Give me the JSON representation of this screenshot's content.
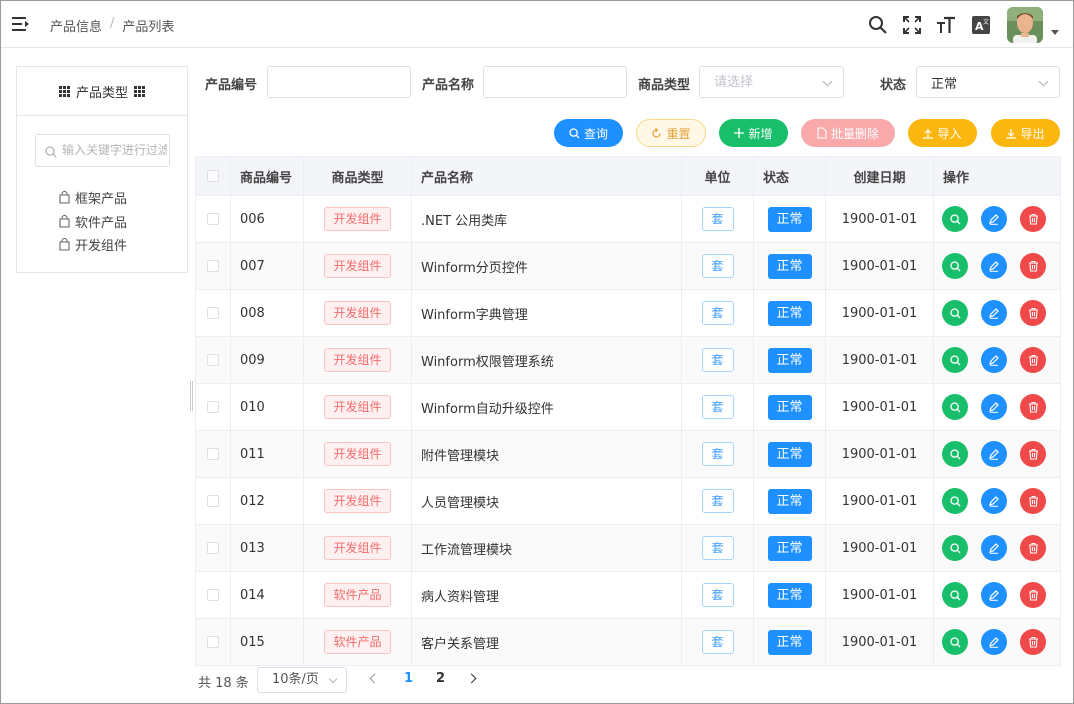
{
  "header": {
    "breadcrumb": [
      "产品信息",
      "产品列表"
    ],
    "breadcrumb_sep": "/"
  },
  "sidebar": {
    "title": "产品类型",
    "search_placeholder": "输入关键字进行过滤",
    "items": [
      {
        "label": "框架产品"
      },
      {
        "label": "软件产品"
      },
      {
        "label": "开发组件"
      }
    ]
  },
  "filters": {
    "code_label": "产品编号",
    "code_value": "",
    "name_label": "产品名称",
    "name_value": "",
    "type_label": "商品类型",
    "type_placeholder": "请选择",
    "status_label": "状态",
    "status_value": "正常"
  },
  "actions": {
    "query": "查询",
    "reset": "重置",
    "add": "新增",
    "batch_delete": "批量删除",
    "import": "导入",
    "export": "导出"
  },
  "table": {
    "columns": [
      "商品编号",
      "商品类型",
      "产品名称",
      "单位",
      "状态",
      "创建日期",
      "操作"
    ],
    "rows": [
      {
        "code": "006",
        "type": "开发组件",
        "name": ".NET 公用类库",
        "unit": "套",
        "status": "正常",
        "date": "1900-01-01"
      },
      {
        "code": "007",
        "type": "开发组件",
        "name": "Winform分页控件",
        "unit": "套",
        "status": "正常",
        "date": "1900-01-01"
      },
      {
        "code": "008",
        "type": "开发组件",
        "name": "Winform字典管理",
        "unit": "套",
        "status": "正常",
        "date": "1900-01-01"
      },
      {
        "code": "009",
        "type": "开发组件",
        "name": "Winform权限管理系统",
        "unit": "套",
        "status": "正常",
        "date": "1900-01-01"
      },
      {
        "code": "010",
        "type": "开发组件",
        "name": "Winform自动升级控件",
        "unit": "套",
        "status": "正常",
        "date": "1900-01-01"
      },
      {
        "code": "011",
        "type": "开发组件",
        "name": "附件管理模块",
        "unit": "套",
        "status": "正常",
        "date": "1900-01-01"
      },
      {
        "code": "012",
        "type": "开发组件",
        "name": "人员管理模块",
        "unit": "套",
        "status": "正常",
        "date": "1900-01-01"
      },
      {
        "code": "013",
        "type": "开发组件",
        "name": "工作流管理模块",
        "unit": "套",
        "status": "正常",
        "date": "1900-01-01"
      },
      {
        "code": "014",
        "type": "软件产品",
        "name": "病人资料管理",
        "unit": "套",
        "status": "正常",
        "date": "1900-01-01"
      },
      {
        "code": "015",
        "type": "软件产品",
        "name": "客户关系管理",
        "unit": "套",
        "status": "正常",
        "date": "1900-01-01"
      }
    ]
  },
  "pager": {
    "total": "共 18 条",
    "page_size": "10条/页",
    "pages": [
      "1",
      "2"
    ],
    "current": "1"
  },
  "colors": {
    "primary": "#1e90ff",
    "success": "#19be6b",
    "danger": "#f0494a",
    "warning": "#fbb70f",
    "danger_light": "#f9a9a9"
  }
}
